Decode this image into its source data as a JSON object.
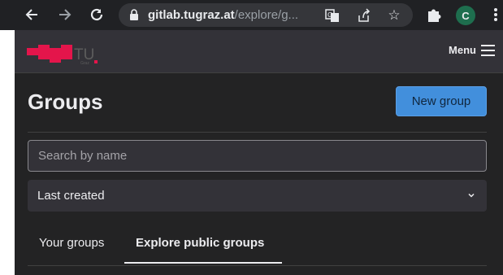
{
  "browser": {
    "url_host": "gitlab.tugraz.at",
    "url_path": "/explore/g...",
    "profile_initial": "C"
  },
  "header": {
    "logo_text": "TU",
    "logo_subtext": "Graz",
    "menu_label": "Menu"
  },
  "main": {
    "title": "Groups",
    "new_group_label": "New group",
    "search_placeholder": "Search by name",
    "sort_selected": "Last created",
    "tabs": [
      {
        "label": "Your groups",
        "active": false
      },
      {
        "label": "Explore public groups",
        "active": true
      }
    ]
  },
  "colors": {
    "accent": "#428fdc",
    "header_bg": "#333238",
    "content_bg": "#232324",
    "logo_red": "#e4154b"
  }
}
